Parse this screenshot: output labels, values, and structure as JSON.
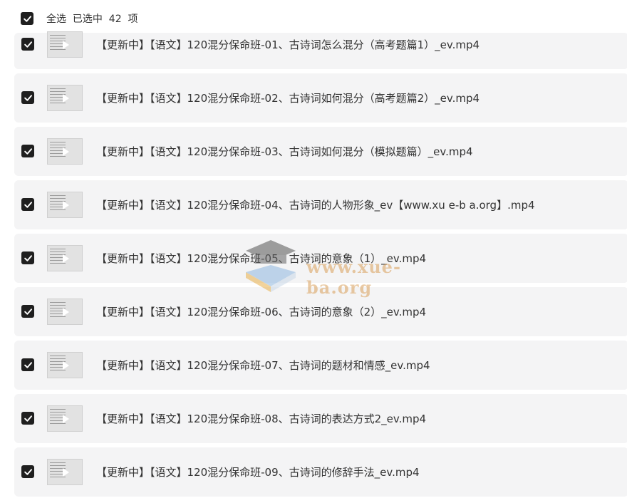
{
  "header": {
    "select_all_label": "全选  已选中  42  项"
  },
  "files": [
    {
      "title": "【更新中】【语文】120混分保命班-01、古诗词怎么混分（高考题篇1）_ev.mp4"
    },
    {
      "title": "【更新中】【语文】120混分保命班-02、古诗词如何混分（高考题篇2）_ev.mp4"
    },
    {
      "title": "【更新中】【语文】120混分保命班-03、古诗词如何混分（模拟题篇）_ev.mp4"
    },
    {
      "title": "【更新中】【语文】120混分保命班-04、古诗词的人物形象_ev【www.xu e-b a.org】.mp4"
    },
    {
      "title": "【更新中】【语文】120混分保命班-05、古诗词的意象（1）_ev.mp4"
    },
    {
      "title": "【更新中】【语文】120混分保命班-06、古诗词的意象（2）_ev.mp4"
    },
    {
      "title": "【更新中】【语文】120混分保命班-07、古诗词的题材和情感_ev.mp4"
    },
    {
      "title": "【更新中】【语文】120混分保命班-08、古诗词的表达方式2_ev.mp4"
    },
    {
      "title": "【更新中】【语文】120混分保命班-09、古诗词的修辞手法_ev.mp4"
    }
  ],
  "watermark": {
    "text": "www.xue-ba.org"
  },
  "colors": {
    "row_bg": "#f4f4f5",
    "checkbox": "#1f1f1f"
  }
}
